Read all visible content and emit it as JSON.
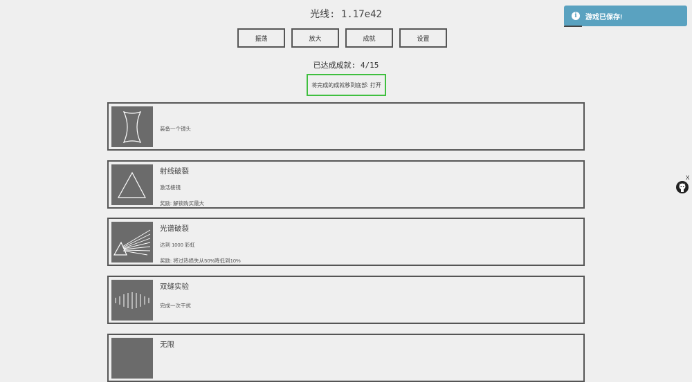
{
  "header": {
    "resource_label": "光线: 1.17e42"
  },
  "tabs": [
    {
      "label": "振荡"
    },
    {
      "label": "放大"
    },
    {
      "label": "成就"
    },
    {
      "label": "设置"
    }
  ],
  "progress_text": "已达成成就: 4/15",
  "toggle_label": "将完成的成就移到底部: 打开",
  "achievements": [
    {
      "title": "",
      "description": "装备一个镜头",
      "reward": "",
      "icon": "lens-icon"
    },
    {
      "title": "射线破裂",
      "description": "激活棱镜",
      "reward": "奖励: 解锁购买最大",
      "icon": "prism-icon"
    },
    {
      "title": "光谱破裂",
      "description": "达到 1000 彩虹",
      "reward": "奖励: 将过热损失从50%降低到10%",
      "icon": "spectrum-icon"
    },
    {
      "title": "双缝实验",
      "description": "完成一次干扰",
      "reward": "",
      "icon": "interference-icon"
    },
    {
      "title": "无限",
      "description": "",
      "reward": "",
      "icon": "infinity-icon"
    }
  ],
  "toast": {
    "message": "游戏已保存!",
    "icon": "info-icon",
    "color": "#5aa2c0"
  },
  "github": {
    "icon": "github-icon",
    "close_label": "X"
  },
  "colors": {
    "background": "#efefef",
    "border": "#555555",
    "toggle_border": "#3fbf3f",
    "thumbnail": "#6b6b6b"
  }
}
